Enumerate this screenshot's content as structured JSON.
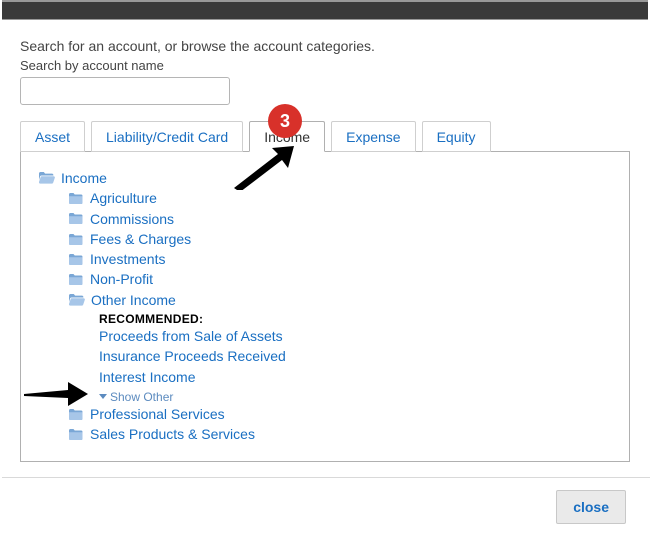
{
  "header": {
    "intro": "Search for an account, or browse the account categories.",
    "search_label": "Search by account name"
  },
  "search": {
    "placeholder": ""
  },
  "tabs": [
    {
      "label": "Asset",
      "active": false
    },
    {
      "label": "Liability/Credit Card",
      "active": false
    },
    {
      "label": "Income",
      "active": true
    },
    {
      "label": "Expense",
      "active": false
    },
    {
      "label": "Equity",
      "active": false
    }
  ],
  "tree": {
    "root": "Income",
    "children": [
      "Agriculture",
      "Commissions",
      "Fees & Charges",
      "Investments",
      "Non-Profit",
      "Other Income",
      "Professional Services",
      "Sales Products & Services"
    ],
    "other_income": {
      "recommended_label": "RECOMMENDED:",
      "items": [
        "Proceeds from Sale of Assets",
        "Insurance Proceeds Received",
        "Interest Income"
      ],
      "show_other": "Show Other"
    }
  },
  "footer": {
    "close": "close"
  },
  "annotation": {
    "step_number": "3"
  }
}
